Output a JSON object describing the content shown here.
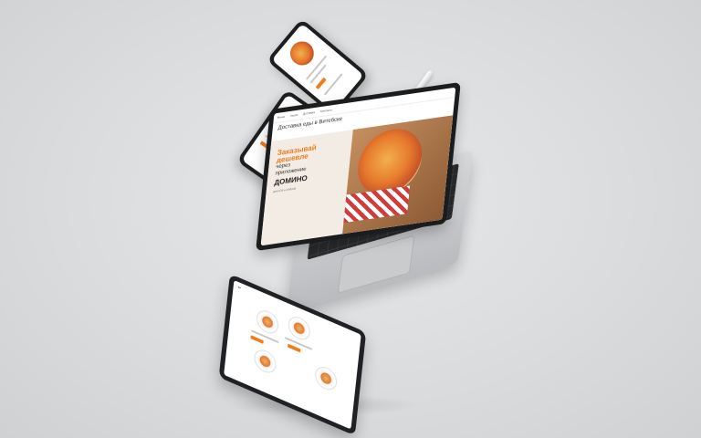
{
  "laptop": {
    "headline": "Доставка еды в Витебске",
    "nav": [
      "Меню",
      "Акции",
      "Доставка",
      "Контакты"
    ],
    "promo": {
      "line1": "Заказывай",
      "line2": "дешевле",
      "line3": "через",
      "line4": "приложение",
      "brand": "ДОМИНО",
      "small": "для iOS и Android"
    }
  },
  "colors": {
    "accent": "#f07d1a",
    "background": "#dcdedf",
    "device_dark": "#1d1e20"
  },
  "icons": [
    "pizza-image",
    "salad-image",
    "pasta-plate-image",
    "stylus-image"
  ]
}
